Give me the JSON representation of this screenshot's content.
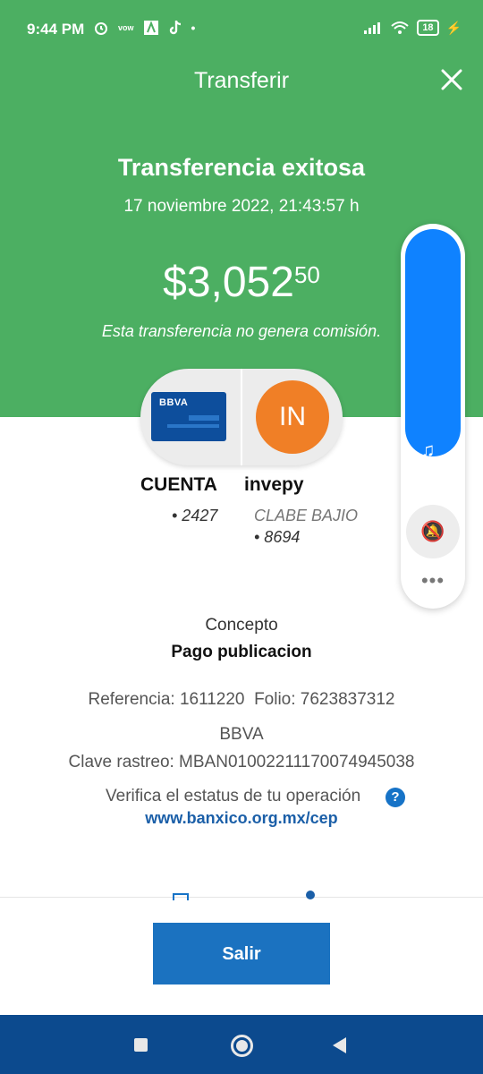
{
  "status_bar": {
    "time": "9:44 PM",
    "app_icons": [
      "alarm-icon",
      "sim-icon",
      "font-icon",
      "tiktok-icon",
      "dot-icon"
    ],
    "right_icons": [
      "signal-icon",
      "wifi-icon",
      "battery-icon",
      "charging-icon"
    ],
    "battery": "18"
  },
  "header": {
    "title": "Transferir",
    "close_icon": "close-icon",
    "bg_color": "#4caf62"
  },
  "result": {
    "heading": "Transferencia exitosa",
    "datetime": "17 noviembre 2022, 21:43:57 h",
    "amount_main": "$3,052",
    "amount_cents": "50",
    "fee_note": "Esta transferencia no genera comisión."
  },
  "from_account": {
    "card_brand": "BBVA",
    "label": "CUENTA",
    "number": "• 2427"
  },
  "to_account": {
    "avatar_initials": "IN",
    "avatar_color": "#f07f26",
    "label": "invepy",
    "bank": "CLABE BAJIO",
    "number": "• 8694"
  },
  "details": {
    "concept_label": "Concepto",
    "concept_value": "Pago publicacion",
    "reference": "Referencia: 1611220",
    "folio": "Folio: 7623837312",
    "bank": "BBVA",
    "tracking": "Clave rastreo: MBAN01002211170074945038",
    "verify_text": "Verifica el estatus de tu operación",
    "help_icon": "?",
    "verify_link": "www.banxico.org.mx/cep"
  },
  "actions": {
    "exit_label": "Salir",
    "button_color": "#1b72c0"
  },
  "floating_panel": {
    "music_icon": "♫",
    "mute_icon": "🔕",
    "more_icon": "•••"
  },
  "nav_bar": {
    "items": [
      "recents-button",
      "home-button",
      "back-button"
    ]
  }
}
